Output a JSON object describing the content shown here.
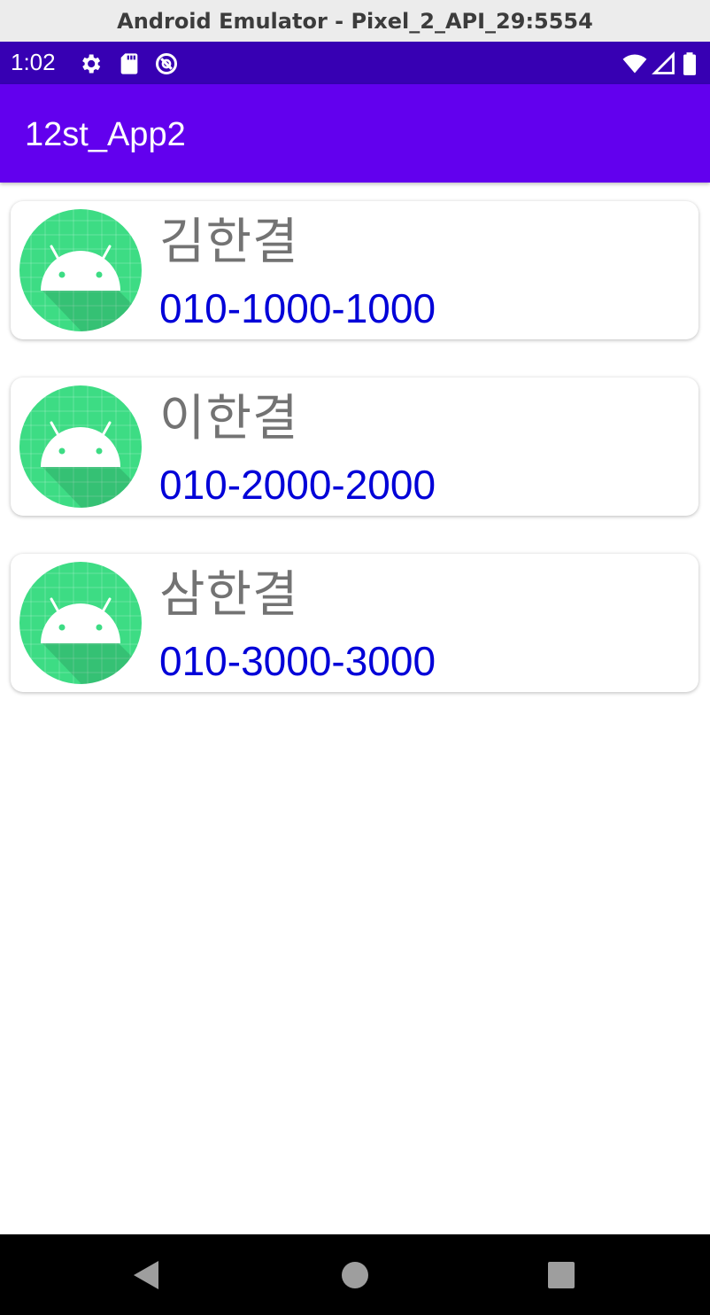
{
  "window": {
    "title": "Android Emulator - Pixel_2_API_29:5554"
  },
  "status_bar": {
    "time": "1:02",
    "left_icons": [
      "settings-icon",
      "sd-card-icon",
      "data-saver-icon"
    ],
    "right_icons": [
      "wifi-icon",
      "cell-signal-icon",
      "battery-icon"
    ]
  },
  "app_bar": {
    "title": "12st_App2"
  },
  "contacts": [
    {
      "name": "김한결",
      "phone": "010-1000-1000"
    },
    {
      "name": "이한결",
      "phone": "010-2000-2000"
    },
    {
      "name": "삼한결",
      "phone": "010-3000-3000"
    }
  ],
  "nav_bar": {
    "buttons": [
      "back-icon",
      "home-icon",
      "recents-icon"
    ]
  },
  "colors": {
    "status_bar": "#3700b3",
    "app_bar": "#6200ee",
    "name_text": "#737373",
    "phone_text": "#0000d8",
    "avatar_bg": "#3ddc84"
  }
}
